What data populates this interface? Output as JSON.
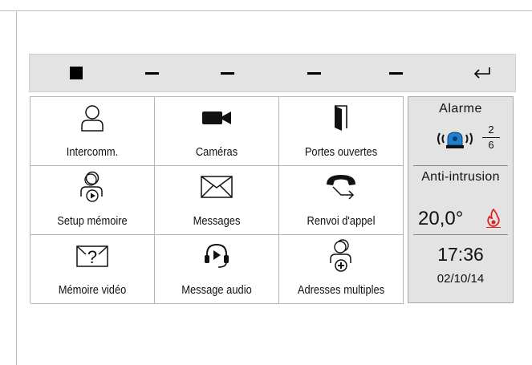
{
  "toolbar": {
    "buttons": [
      {
        "icon": "stop-square-icon"
      },
      {
        "icon": "dash-icon"
      },
      {
        "icon": "dash-icon"
      },
      {
        "icon": "dash-icon"
      },
      {
        "icon": "dash-icon"
      },
      {
        "icon": "return-arrow-icon"
      }
    ]
  },
  "menu": {
    "items": [
      {
        "label": "Intercomm.",
        "icon": "person-icon"
      },
      {
        "label": "Caméras",
        "icon": "video-camera-icon"
      },
      {
        "label": "Portes ouvertes",
        "icon": "open-door-icon"
      },
      {
        "label": "Setup mémoire",
        "icon": "person-play-icon"
      },
      {
        "label": "Messages",
        "icon": "envelope-icon"
      },
      {
        "label": "Renvoi d'appel",
        "icon": "call-forward-icon"
      },
      {
        "label": "Mémoire vidéo",
        "icon": "envelope-question-icon"
      },
      {
        "label": "Message audio",
        "icon": "headset-play-icon"
      },
      {
        "label": "Adresses multiples",
        "icon": "people-add-icon"
      }
    ]
  },
  "status": {
    "alarm_title": "Alarme",
    "alarm_count": "2",
    "alarm_total": "6",
    "anti_intrusion": "Anti-intrusion",
    "temperature": "20,0°",
    "time": "17:36",
    "date": "02/10/14"
  },
  "colors": {
    "toolbar_bg": "#e3e3e3",
    "status_bg": "#e3e3e3",
    "alarm_blue": "#1f7fd1",
    "flame_red": "#e02020"
  }
}
